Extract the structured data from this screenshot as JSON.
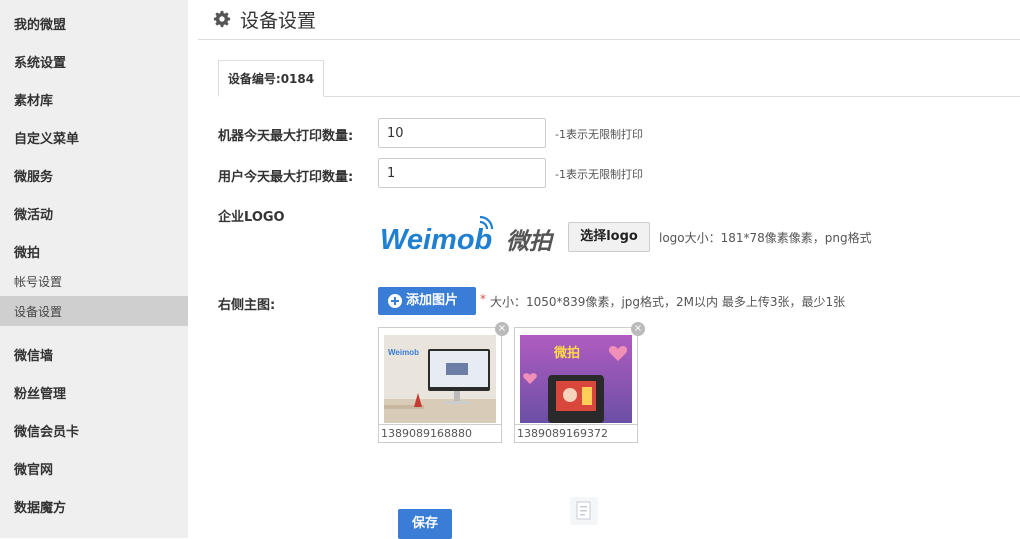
{
  "sidebar": {
    "items": [
      {
        "label": "我的微盟"
      },
      {
        "label": "系统设置"
      },
      {
        "label": "素材库"
      },
      {
        "label": "自定义菜单"
      },
      {
        "label": "微服务"
      },
      {
        "label": "微活动"
      },
      {
        "label": "微拍"
      },
      {
        "label": "帐号设置"
      },
      {
        "label": "设备设置"
      },
      {
        "label": "微信墙"
      },
      {
        "label": "粉丝管理"
      },
      {
        "label": "微信会员卡"
      },
      {
        "label": "微官网"
      },
      {
        "label": "数据魔方"
      }
    ],
    "active_item": "设备设置"
  },
  "header": {
    "title": "设备设置",
    "icon": "gear-icon"
  },
  "tab": {
    "label": "设备编号:0184"
  },
  "form": {
    "machine_limit": {
      "label": "机器今天最大打印数量:",
      "value": "10",
      "hint": "-1表示无限制打印"
    },
    "user_limit": {
      "label": "用户今天最大打印数量:",
      "value": "1",
      "hint": "-1表示无限制打印"
    },
    "logo": {
      "label": "企业LOGO",
      "brand_text": "Weimob",
      "brand_cn": "微拍",
      "choose_label": "选择logo",
      "hint": "logo大小：181*78像素像素，png格式"
    },
    "main_image": {
      "label": "右侧主图:",
      "add_label": "添加图片",
      "required_mark": "*",
      "hint": "大小：1050*839像素，jpg格式，2M以内 最多上传3张，最少1张",
      "images": [
        {
          "name": "1389089168880",
          "thumb_text": "Weimob",
          "close": "×"
        },
        {
          "name": "1389089169372",
          "thumb_text": "微拍",
          "close": "×"
        }
      ]
    },
    "save_label": "保存"
  },
  "colors": {
    "primary": "#3a7dd6",
    "logo_blue": "#1f7fd0",
    "sidebar_bg": "#efefef",
    "sidebar_active": "#cfcfcf"
  }
}
